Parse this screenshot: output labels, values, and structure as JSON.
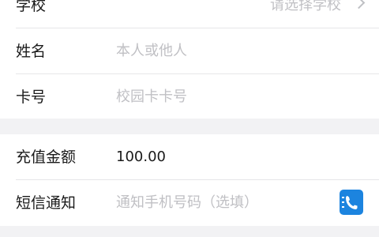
{
  "form": {
    "school": {
      "label": "学校",
      "placeholder": "请选择学校"
    },
    "name": {
      "label": "姓名",
      "placeholder": "本人或他人"
    },
    "card": {
      "label": "卡号",
      "placeholder": "校园卡卡号"
    },
    "amount": {
      "label": "充值金额",
      "value": "100.00"
    },
    "sms": {
      "label": "短信通知",
      "placeholder": "通知手机号码（选填）"
    }
  },
  "icons": {
    "school_chevron": "chevron-right-icon",
    "sms_contact": "phone-contact-icon"
  },
  "colors": {
    "accent": "#1c84df",
    "background": "#f2f2f4",
    "placeholder": "#c0c0c4",
    "text": "#1a1a1a"
  }
}
